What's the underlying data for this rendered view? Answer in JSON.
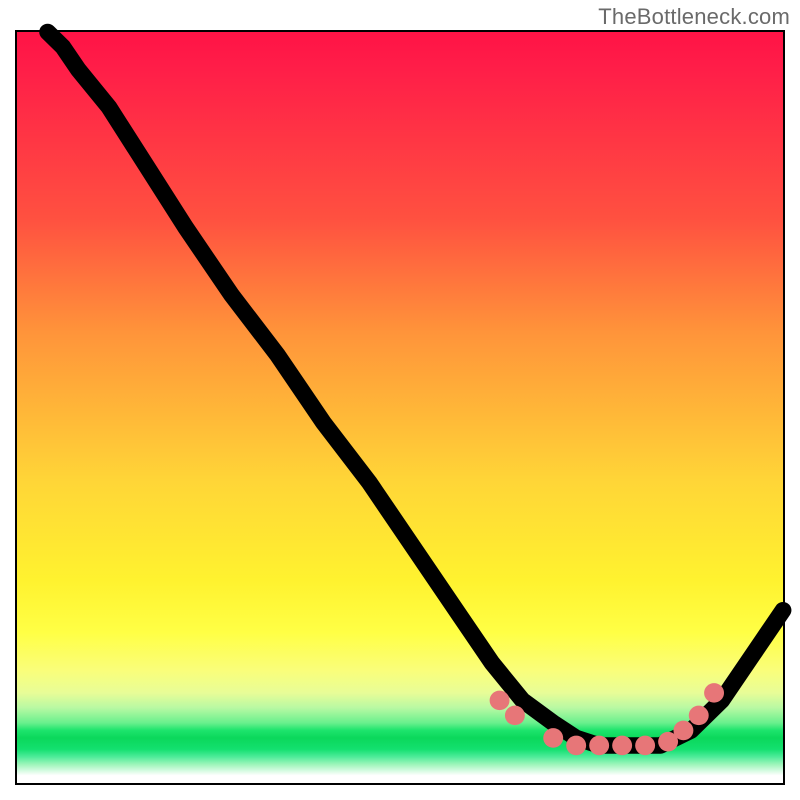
{
  "watermark": "TheBottleneck.com",
  "chart_data": {
    "type": "line",
    "title": "",
    "xlabel": "",
    "ylabel": "",
    "xlim": [
      0,
      100
    ],
    "ylim": [
      0,
      100
    ],
    "note": "x and y are in percent of the plot area; y=0 is bottom, y=100 is top. Axes are unlabeled in the image.",
    "series": [
      {
        "name": "curve",
        "kind": "line",
        "x": [
          4,
          6,
          8,
          12,
          17,
          22,
          28,
          34,
          40,
          46,
          52,
          58,
          62,
          66,
          70,
          73,
          76,
          80,
          84,
          88,
          92,
          96,
          100
        ],
        "y": [
          100,
          98,
          95,
          90,
          82,
          74,
          65,
          57,
          48,
          40,
          31,
          22,
          16,
          11,
          8,
          6,
          5,
          5,
          5,
          7,
          11,
          17,
          23
        ]
      },
      {
        "name": "dots",
        "kind": "scatter",
        "x": [
          63,
          65,
          70,
          73,
          76,
          79,
          82,
          85,
          87,
          89,
          91
        ],
        "y": [
          11,
          9,
          6,
          5,
          5,
          5,
          5,
          5.5,
          7,
          9,
          12
        ]
      }
    ],
    "background_gradient": {
      "direction": "top-to-bottom",
      "stops": [
        {
          "pos": 0.0,
          "color": "#ff1346"
        },
        {
          "pos": 0.25,
          "color": "#ff5140"
        },
        {
          "pos": 0.5,
          "color": "#ffb838"
        },
        {
          "pos": 0.73,
          "color": "#fff22f"
        },
        {
          "pos": 0.9,
          "color": "#b8f9a3"
        },
        {
          "pos": 0.94,
          "color": "#0bd85b"
        },
        {
          "pos": 0.99,
          "color": "#ffffff"
        }
      ]
    }
  }
}
